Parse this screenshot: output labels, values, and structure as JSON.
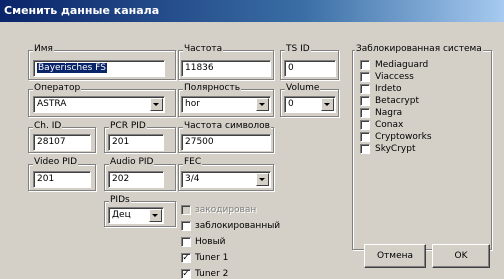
{
  "window": {
    "title": "Сменить данные канала"
  },
  "name": {
    "label": "Имя",
    "value": "Bayerisches FS"
  },
  "frequency": {
    "label": "Частота",
    "value": "11836"
  },
  "ts_id": {
    "label": "TS ID",
    "value": "0"
  },
  "operator": {
    "label": "Оператор",
    "value": "ASTRA"
  },
  "polarity": {
    "label": "Полярность",
    "value": "hor"
  },
  "volume": {
    "label": "Volume",
    "value": "0"
  },
  "ch_id": {
    "label": "Ch. ID",
    "value": "28107"
  },
  "pcr_pid": {
    "label": "PCR PID",
    "value": "201"
  },
  "symbol_rate": {
    "label": "Частота символов",
    "value": "27500"
  },
  "video_pid": {
    "label": "Video PID",
    "value": "201"
  },
  "audio_pid": {
    "label": "Audio PID",
    "value": "202"
  },
  "fec": {
    "label": "FEC",
    "value": "3/4"
  },
  "pids": {
    "label": "PIDs",
    "value": "Дец"
  },
  "flags": [
    {
      "label": "закодирован",
      "checked": false,
      "enabled": false
    },
    {
      "label": "заблокированный",
      "checked": false,
      "enabled": true
    },
    {
      "label": "Новый",
      "checked": false,
      "enabled": true
    },
    {
      "label": "Tuner 1",
      "checked": true,
      "enabled": true
    },
    {
      "label": "Tuner 2",
      "checked": true,
      "enabled": true
    }
  ],
  "locked_system": {
    "label": "Заблокированная система",
    "items": [
      {
        "label": "Mediaguard",
        "checked": false
      },
      {
        "label": "Viaccess",
        "checked": false
      },
      {
        "label": "Irdeto",
        "checked": false
      },
      {
        "label": "Betacrypt",
        "checked": false
      },
      {
        "label": "Nagra",
        "checked": false
      },
      {
        "label": "Conax",
        "checked": false
      },
      {
        "label": "Cryptoworks",
        "checked": false
      },
      {
        "label": "SkyCrypt",
        "checked": false
      }
    ]
  },
  "buttons": {
    "cancel": "Отмена",
    "ok": "OK"
  }
}
